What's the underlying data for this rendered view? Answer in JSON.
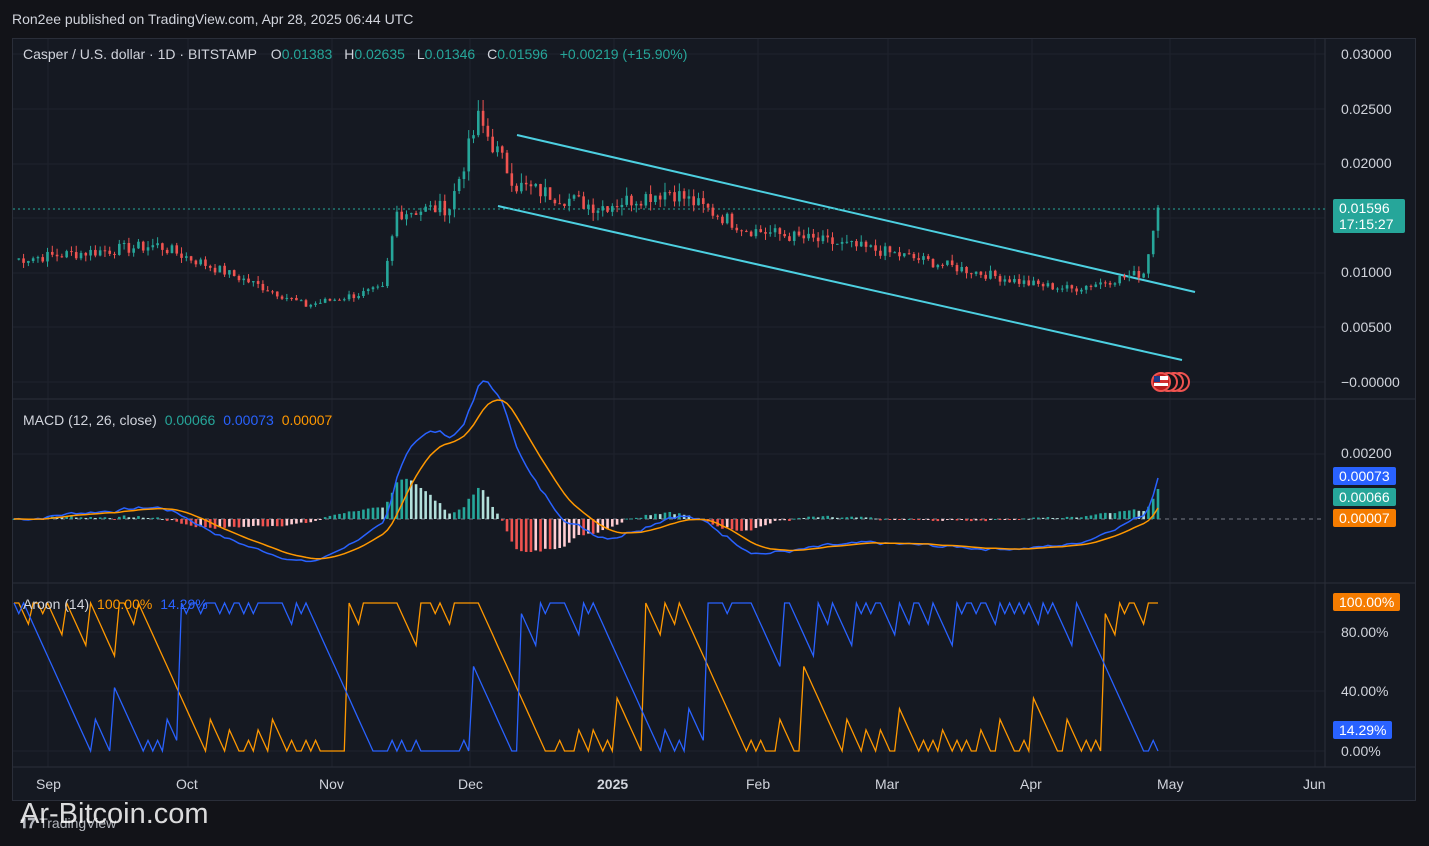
{
  "header": {
    "publish_text": "Ron2ee published on TradingView.com, Apr 28, 2025 06:44 UTC"
  },
  "symbol": {
    "title": "Casper / U.S. dollar · 1D · BITSTAMP",
    "o_label": "O",
    "o_value": "0.01383",
    "h_label": "H",
    "h_value": "0.02635",
    "l_label": "L",
    "l_value": "0.01346",
    "c_label": "C",
    "c_value": "0.01596",
    "change": "+0.00219 (+15.90%)"
  },
  "price_axis": [
    "0.03000",
    "0.02500",
    "0.02000",
    "0.01000",
    "0.00500",
    "−0.00000"
  ],
  "last_price": {
    "value": "0.01596",
    "countdown": "17:15:27"
  },
  "macd": {
    "title": "MACD (12, 26, close)",
    "hist_value": "0.00066",
    "macd_value": "0.00073",
    "signal_value": "0.00007",
    "axis": [
      "0.00200"
    ],
    "tags": {
      "macd": "0.00073",
      "hist": "0.00066",
      "signal": "0.00007"
    }
  },
  "aroon": {
    "title": "Aroon (14)",
    "up_value": "100.00%",
    "down_value": "14.29%",
    "axis": [
      "80.00%",
      "40.00%",
      "0.00%"
    ],
    "tags": {
      "up": "100.00%",
      "down": "14.29%"
    }
  },
  "time_axis": [
    "Sep",
    "Oct",
    "Nov",
    "Dec",
    "2025",
    "Feb",
    "Mar",
    "Apr",
    "May",
    "Jun"
  ],
  "watermark": "Ar-Bitcoin.com",
  "tv_logo": "TradingView",
  "colors": {
    "up": "#26a69a",
    "down": "#ef5350",
    "macd": "#2962ff",
    "signal": "#ff9800",
    "channel": "#4dd0e1",
    "aroon_up": "#ff9800",
    "aroon_down": "#2962ff"
  },
  "chart_data": {
    "type": "candlestick",
    "series": [
      {
        "name": "Casper / U.S. dollar"
      }
    ],
    "anchors": [
      {
        "date": "2024-09-01",
        "close": 0.0112
      },
      {
        "date": "2024-10-01",
        "close": 0.0125
      },
      {
        "date": "2024-10-24",
        "close": 0.0085
      },
      {
        "date": "2024-11-01",
        "close": 0.007
      },
      {
        "date": "2024-11-17",
        "close": 0.0085
      },
      {
        "date": "2024-11-20",
        "close": 0.0155
      },
      {
        "date": "2024-12-01",
        "close": 0.016
      },
      {
        "date": "2024-12-07",
        "close": 0.024
      },
      {
        "date": "2024-12-15",
        "close": 0.018
      },
      {
        "date": "2025-01-01",
        "close": 0.016
      },
      {
        "date": "2025-01-16",
        "close": 0.0175
      },
      {
        "date": "2025-02-01",
        "close": 0.014
      },
      {
        "date": "2025-03-01",
        "close": 0.012
      },
      {
        "date": "2025-04-01",
        "close": 0.009
      },
      {
        "date": "2025-04-10",
        "close": 0.0085
      },
      {
        "date": "2025-04-25",
        "close": 0.01
      },
      {
        "date": "2025-04-28",
        "close": 0.01596
      }
    ],
    "ylim": [
      0,
      0.03
    ]
  }
}
